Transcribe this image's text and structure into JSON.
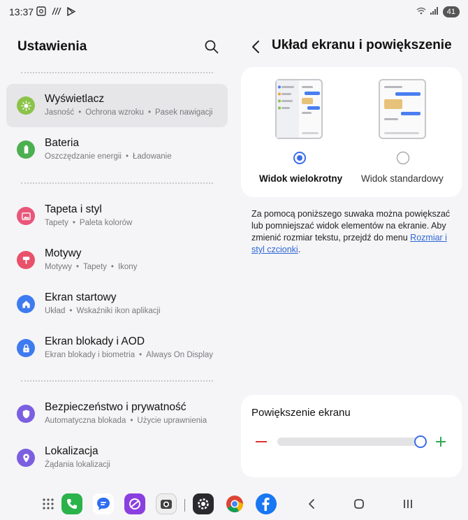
{
  "status_bar": {
    "time": "13:37",
    "icons": [
      "screenshot-icon",
      "nfc-icon",
      "play-store-icon"
    ],
    "battery": "41",
    "signal_icons": [
      "wifi-icon",
      "signal-icon"
    ]
  },
  "left_pane": {
    "title": "Ustawienia",
    "items": [
      {
        "title": "Wyświetlacz",
        "subtitle": [
          "Jasność",
          "Ochrona wzroku",
          "Pasek nawigacji"
        ],
        "icon": "sun-icon",
        "color": "#8bc34a",
        "selected": true
      },
      {
        "title": "Bateria",
        "subtitle": [
          "Oszczędzanie energii",
          "Ładowanie"
        ],
        "icon": "battery-icon",
        "color": "#4caf50"
      },
      {
        "title": "Tapeta i styl",
        "subtitle": [
          "Tapety",
          "Paleta kolorów"
        ],
        "icon": "image-icon",
        "color": "#e85679"
      },
      {
        "title": "Motywy",
        "subtitle": [
          "Motywy",
          "Tapety",
          "Ikony"
        ],
        "icon": "brush-icon",
        "color": "#e9516b"
      },
      {
        "title": "Ekran startowy",
        "subtitle": [
          "Układ",
          "Wskaźniki ikon aplikacji"
        ],
        "icon": "home-icon",
        "color": "#3e7bf0"
      },
      {
        "title": "Ekran blokady i AOD",
        "subtitle": [
          "Ekran blokady i biometria",
          "Always On Display"
        ],
        "icon": "lock-icon",
        "color": "#3e7bf0"
      },
      {
        "title": "Bezpieczeństwo i prywatność",
        "subtitle": [
          "Automatyczna blokada",
          "Użycie uprawnienia"
        ],
        "icon": "shield-icon",
        "color": "#7b5fe0"
      },
      {
        "title": "Lokalizacja",
        "subtitle": [
          "Żądania lokalizacji"
        ],
        "icon": "location-icon",
        "color": "#7b5fe0"
      }
    ]
  },
  "right_pane": {
    "title": "Układ ekranu i powiększenie",
    "options": [
      {
        "label": "Widok wielokrotny",
        "selected": true
      },
      {
        "label": "Widok standardowy",
        "selected": false
      }
    ],
    "description": "Za pomocą poniższego suwaka można powiększać lub pomniejszać widok elementów na ekranie. Aby zmienić rozmiar tekstu, przejdź do menu ",
    "description_link": "Rozmiar i styl czcionki",
    "description_end": ".",
    "zoom_title": "Powiększenie ekranu",
    "zoom_level": 1.0
  },
  "dock": {
    "apps": [
      "apps-grid-icon",
      "phone-icon",
      "messages-icon",
      "galaxy-store-icon",
      "camera-icon",
      "settings-icon",
      "chrome-icon",
      "facebook-icon"
    ],
    "nav": [
      "back-icon",
      "home-icon",
      "recents-icon"
    ]
  },
  "colors": {
    "accent": "#3d6ee9",
    "minus": "#dd3333",
    "plus": "#2fa84f"
  }
}
